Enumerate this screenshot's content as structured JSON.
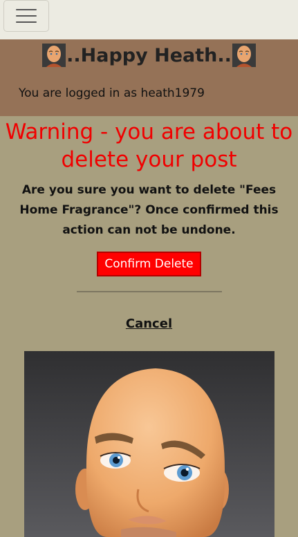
{
  "navbar": {
    "menu_icon": "hamburger-menu-icon"
  },
  "header": {
    "title": "..Happy Heath..",
    "logged_in_text": "You are logged in as heath1979",
    "avatar_icon": "user-avatar-icon"
  },
  "main": {
    "warning": "Warning - you are about to delete your post",
    "question": "Are you sure you want to delete \"Fees Home Fragrance\"? Once confirmed this action can not be undone.",
    "confirm_label": "Confirm Delete",
    "cancel_label": "Cancel"
  },
  "colors": {
    "navbar_bg": "#ecebe2",
    "header_bg": "#957257",
    "page_bg": "#a89f7f",
    "warning": "#f00000",
    "button_bg": "#ff0000"
  }
}
